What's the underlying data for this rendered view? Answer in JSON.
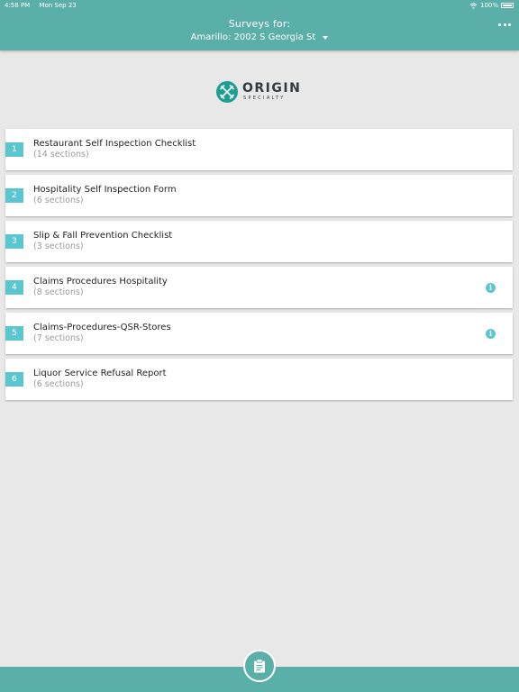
{
  "status_bar": {
    "time": "4:58 PM",
    "date": "Mon Sep 23",
    "battery": "100%"
  },
  "header": {
    "title": "Surveys for:",
    "location": "Amarillo: 2002 S Georgia St"
  },
  "logo": {
    "name": "ORIGIN",
    "subtitle": "SPECIALTY"
  },
  "surveys": [
    {
      "number": "1",
      "title": "Restaurant Self Inspection Checklist",
      "sections": "(14 sections)",
      "info": false
    },
    {
      "number": "2",
      "title": "Hospitality Self Inspection Form",
      "sections": "(6 sections)",
      "info": false
    },
    {
      "number": "3",
      "title": "Slip & Fall Prevention Checklist",
      "sections": "(3 sections)",
      "info": false
    },
    {
      "number": "4",
      "title": "Claims Procedures Hospitality",
      "sections": "(8 sections)",
      "info": true
    },
    {
      "number": "5",
      "title": "Claims-Procedures-QSR-Stores",
      "sections": "(7 sections)",
      "info": true
    },
    {
      "number": "6",
      "title": "Liquor Service Refusal Report",
      "sections": "(6 sections)",
      "info": false
    }
  ],
  "colors": {
    "header": "#5aafa8",
    "accent": "#5bc6ce",
    "background": "#e8e8e8"
  },
  "icons": {
    "more": "more-icon",
    "dropdown": "chevron-down-icon",
    "info": "info-icon",
    "fab": "clipboard-icon"
  }
}
